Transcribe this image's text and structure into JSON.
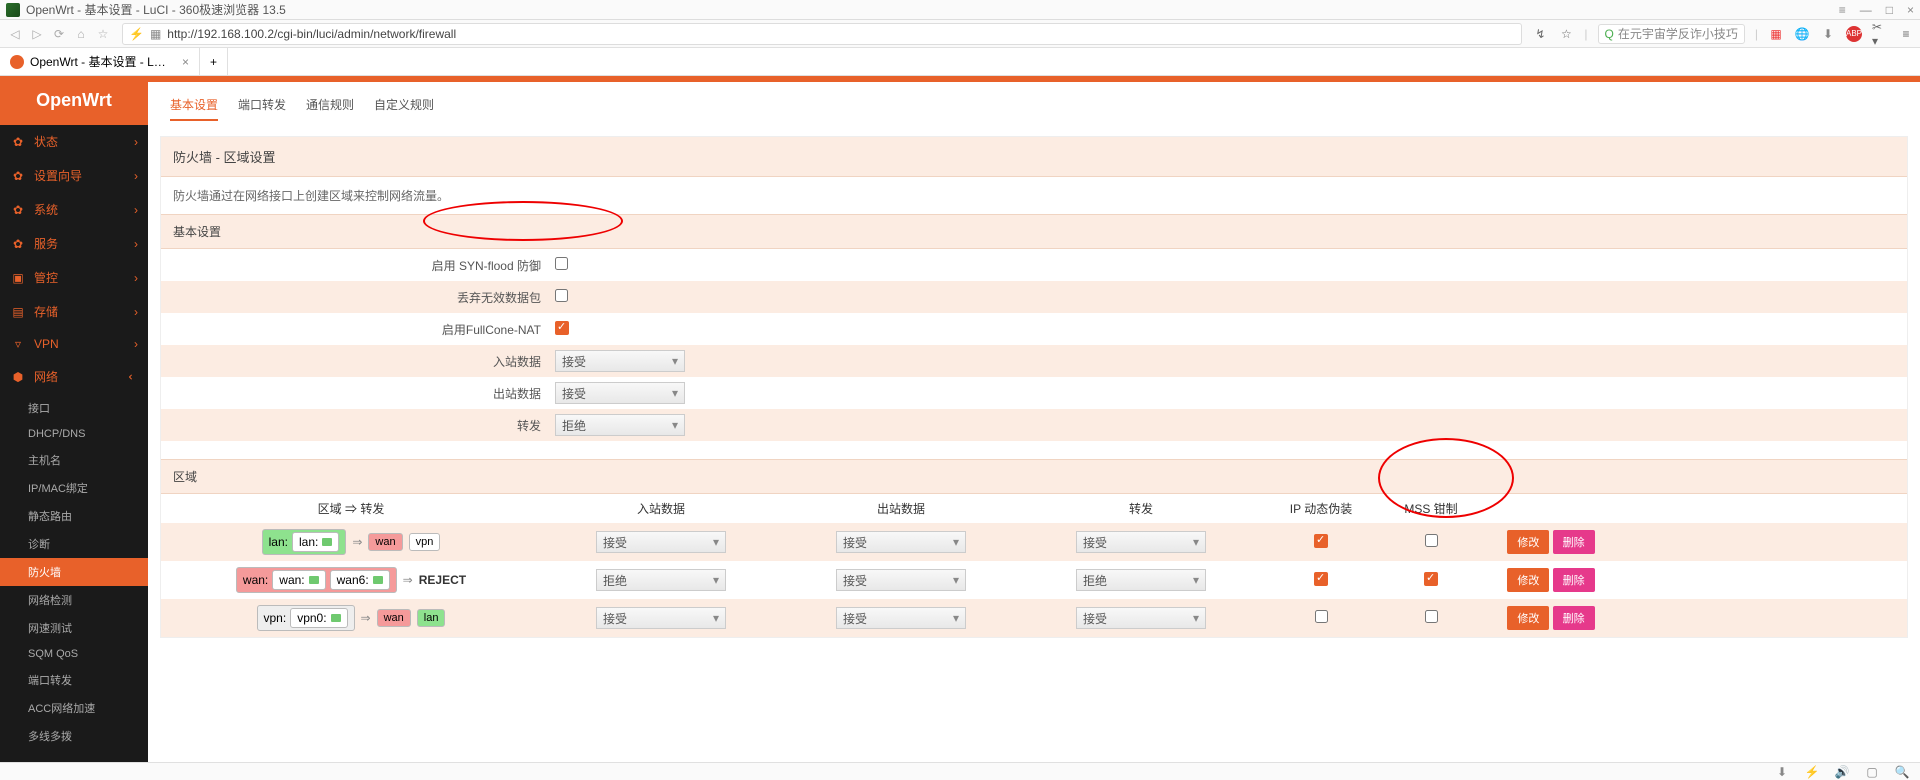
{
  "window": {
    "title": "OpenWrt - 基本设置 - LuCI - 360极速浏览器 13.5",
    "close": "×",
    "min": "—",
    "max": "□",
    "menu": "≡"
  },
  "toolbar": {
    "url": "http://192.168.100.2/cgi-bin/luci/admin/network/firewall",
    "search_placeholder": "在元宇宙学反诈小技巧"
  },
  "tab": {
    "title": "OpenWrt - 基本设置 - LuCI",
    "close": "×",
    "add": "+"
  },
  "brand": "OpenWrt",
  "nav": {
    "status": "状态",
    "wizard": "设置向导",
    "system": "系统",
    "services": "服务",
    "control": "管控",
    "storage": "存储",
    "vpn": "VPN",
    "network": "网络",
    "chev": "›"
  },
  "subnav": {
    "interfaces": "接口",
    "dhcp": "DHCP/DNS",
    "hostnames": "主机名",
    "ipmac": "IP/MAC绑定",
    "routes": "静态路由",
    "diagnostics": "诊断",
    "firewall": "防火墙",
    "netspeed": "网络检测",
    "nettest": "网速测试",
    "sqm": "SQM QoS",
    "portforward_sub": "端口转发",
    "acc": "ACC网络加速",
    "multiwan": "多线多拨"
  },
  "tabs": {
    "basic": "基本设置",
    "portforward": "端口转发",
    "traffic": "通信规则",
    "custom": "自定义规则"
  },
  "page": {
    "title": "防火墙 - 区域设置",
    "desc": "防火墙通过在网络接口上创建区域来控制网络流量。",
    "section_basic": "基本设置",
    "section_zones": "区域"
  },
  "form": {
    "synflood": "启用 SYN-flood 防御",
    "dropinvalid": "丢弃无效数据包",
    "fullcone": "启用FullCone-NAT",
    "input": "入站数据",
    "output": "出站数据",
    "forward": "转发",
    "accept": "接受",
    "reject": "拒绝"
  },
  "zones": {
    "head_zone": "区域 ⇒ 转发",
    "head_input": "入站数据",
    "head_output": "出站数据",
    "head_forward": "转发",
    "head_masq": "IP 动态伪装",
    "head_mss": "MSS 钳制",
    "btn_edit": "修改",
    "btn_delete": "删除",
    "reject": "REJECT",
    "accept_opt": "接受",
    "reject_opt": "拒绝",
    "rows": [
      {
        "left_name": "lan:",
        "left_if": "lan:",
        "targets": [
          "wan",
          "vpn"
        ],
        "in": "接受",
        "out": "接受",
        "fwd": "接受",
        "masq": true,
        "mss": false
      },
      {
        "left_name": "wan:",
        "left_ifs": [
          "wan:",
          "wan6:"
        ],
        "reject": true,
        "in": "拒绝",
        "out": "接受",
        "fwd": "拒绝",
        "masq": true,
        "mss": true
      },
      {
        "left_name": "vpn:",
        "left_if": "vpn0:",
        "targets": [
          "wan",
          "lan"
        ],
        "in": "接受",
        "out": "接受",
        "fwd": "接受",
        "masq": false,
        "mss": false
      }
    ],
    "arrow": "⇒"
  },
  "chart_data": null
}
